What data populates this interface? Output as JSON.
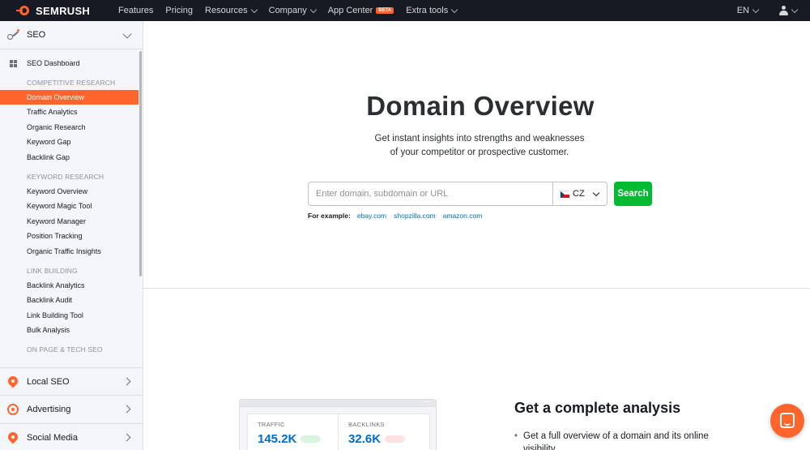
{
  "brand": {
    "name": "SEMRUSH"
  },
  "topnav": {
    "items": [
      {
        "label": "Features",
        "dropdown": false
      },
      {
        "label": "Pricing",
        "dropdown": false
      },
      {
        "label": "Resources",
        "dropdown": true
      },
      {
        "label": "Company",
        "dropdown": true
      },
      {
        "label": "App Center",
        "dropdown": false,
        "badge": "BETA"
      },
      {
        "label": "Extra tools",
        "dropdown": true
      }
    ],
    "language": "EN"
  },
  "sidebar": {
    "seo_label": "SEO",
    "dashboard": "SEO Dashboard",
    "groups": [
      {
        "title": "COMPETITIVE RESEARCH",
        "items": [
          "Domain Overview",
          "Traffic Analytics",
          "Organic Research",
          "Keyword Gap",
          "Backlink Gap"
        ]
      },
      {
        "title": "KEYWORD RESEARCH",
        "items": [
          "Keyword Overview",
          "Keyword Magic Tool",
          "Keyword Manager",
          "Position Tracking",
          "Organic Traffic Insights"
        ]
      },
      {
        "title": "LINK BUILDING",
        "items": [
          "Backlink Analytics",
          "Backlink Audit",
          "Link Building Tool",
          "Bulk Analysis"
        ]
      },
      {
        "title": "ON PAGE & TECH SEO",
        "items": []
      }
    ],
    "active_item": "Domain Overview",
    "sections": [
      {
        "label": "Local SEO",
        "icon": "pin-icon"
      },
      {
        "label": "Advertising",
        "icon": "target-icon"
      },
      {
        "label": "Social Media",
        "icon": "pin-icon"
      }
    ]
  },
  "hero": {
    "title": "Domain Overview",
    "subtitle_line1": "Get instant insights into strengths and weaknesses",
    "subtitle_line2": "of your competitor or prospective customer.",
    "search_placeholder": "Enter domain, subdomain or URL",
    "database": "CZ",
    "search_button": "Search",
    "examples_label": "For example:",
    "examples": [
      "ebay.com",
      "shopzilla.com",
      "amazon.com"
    ]
  },
  "preview": {
    "dots": "•••",
    "metrics": [
      {
        "label": "TRAFFIC",
        "value": "145.2K"
      },
      {
        "label": "BACKLINKS",
        "value": "32.6K"
      }
    ]
  },
  "analysis": {
    "title": "Get a complete analysis",
    "bullets": [
      "Get a full overview of a domain and its online visibility"
    ]
  },
  "colors": {
    "accent": "#ff642d",
    "search_green": "#00ba31",
    "link_blue": "#006dca",
    "nav_bg": "#171a22"
  }
}
